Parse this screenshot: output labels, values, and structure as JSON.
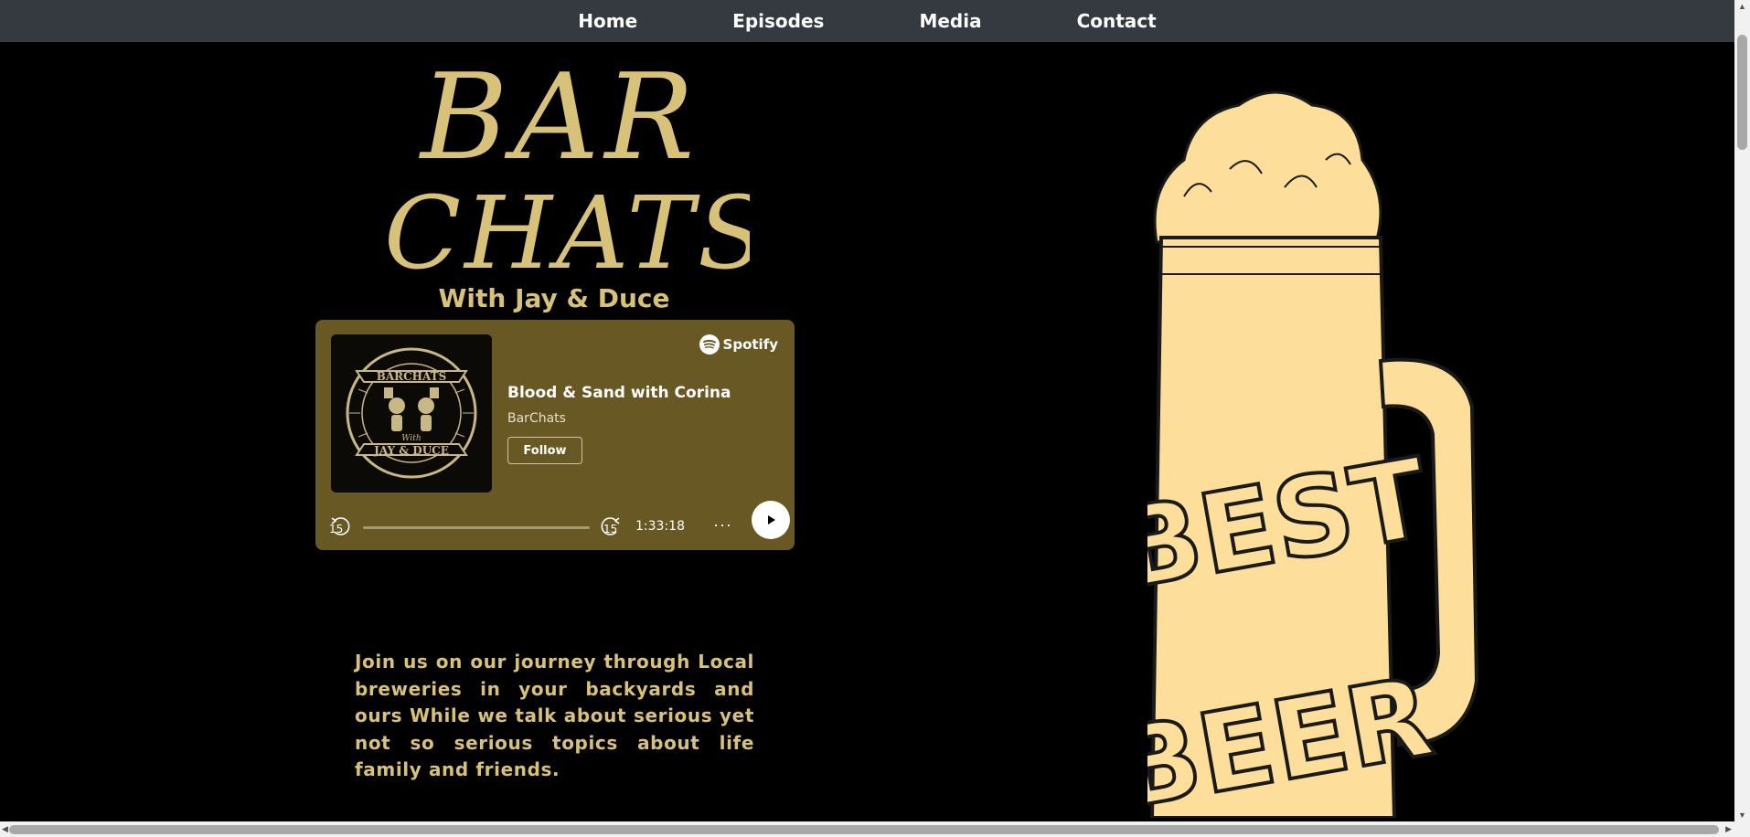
{
  "nav": {
    "items": [
      {
        "label": "Home"
      },
      {
        "label": "Episodes"
      },
      {
        "label": "Media"
      },
      {
        "label": "Contact"
      }
    ]
  },
  "hero": {
    "logo_line1": "BAR",
    "logo_line2": "CHATS",
    "tagline": "With Jay & Duce"
  },
  "player": {
    "brand": "Spotify",
    "episode_title": "Blood & Sand with Corina",
    "show_name": "BarChats",
    "follow_label": "Follow",
    "skip_back": "15",
    "skip_forward": "15",
    "duration": "1:33:18",
    "progress": 0.0,
    "more_label": "···",
    "cover_text_top": "BARCHATS",
    "cover_text_mid": "With",
    "cover_text_bottom": "JAY & DUCE"
  },
  "description": "Join us on our journey through Local breweries in your backyards and ours While we talk about serious yet not so serious topics about life family and friends.",
  "illustration": {
    "text_line1": "BEST",
    "text_line2": "BEER"
  },
  "colors": {
    "gold": "#d8c27a",
    "nav_bg": "#343a40",
    "player_bg": "#675824",
    "beer": "#fddf9b"
  }
}
